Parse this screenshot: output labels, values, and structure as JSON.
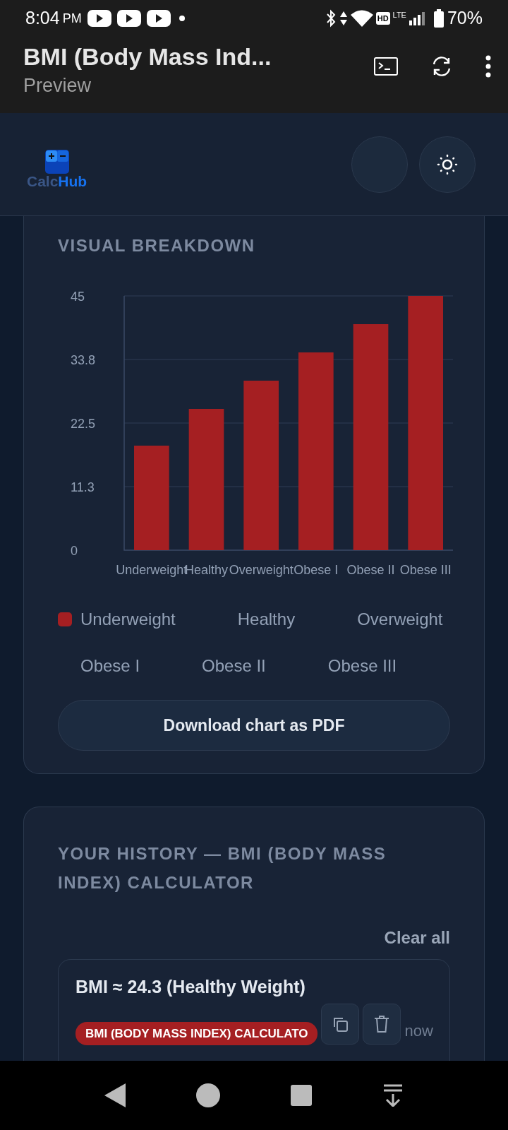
{
  "status_bar": {
    "time": "8:04",
    "ampm": "PM",
    "hd": "HD",
    "network": "LTE",
    "battery": "70%"
  },
  "app_bar": {
    "title": "BMI (Body Mass Ind...",
    "subtitle": "Preview"
  },
  "site_header": {
    "logo_part1": "Calc",
    "logo_part2": "Hub"
  },
  "breakdown": {
    "title": "VISUAL BREAKDOWN",
    "chart_data": {
      "type": "bar",
      "categories": [
        "Underweight",
        "Healthy",
        "Overweight",
        "Obese I",
        "Obese II",
        "Obese III"
      ],
      "series": [
        {
          "name": "Underweight",
          "color": "#a51f22",
          "values": [
            18.5,
            25,
            30,
            35,
            40,
            45
          ]
        }
      ],
      "grid": true,
      "ylim": [
        0,
        45
      ],
      "yticks": [
        0,
        {
          "value": 11.25,
          "label": "11.3"
        },
        22.5,
        {
          "value": 33.75,
          "label": "33.8"
        },
        45
      ]
    },
    "legend": [
      {
        "label": "Healthy"
      },
      {
        "label": "Overweight"
      },
      {
        "label": "Obese I"
      },
      {
        "label": "Obese II"
      },
      {
        "label": "Obese III"
      }
    ],
    "download_button": "Download chart as PDF"
  },
  "history": {
    "title": "YOUR HISTORY — BMI (BODY MASS INDEX) CALCULATOR",
    "clear_button": "Clear all",
    "entries": [
      {
        "result": "BMI ≈ 24.3 (Healthy Weight)",
        "tag": "BMI (BODY MASS INDEX) CALCULATO",
        "time": "now"
      }
    ]
  }
}
